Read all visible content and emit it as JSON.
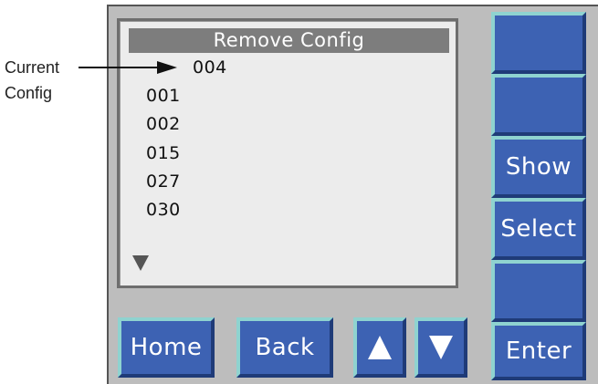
{
  "callout": {
    "line1": "Current",
    "line2": "Config"
  },
  "screen": {
    "title": "Remove Config",
    "current_config": "004",
    "configs": [
      "001",
      "002",
      "015",
      "027",
      "030"
    ],
    "scroll_indicator_icon": "triangle-down-icon"
  },
  "side_buttons": {
    "blank_1": "",
    "blank_2": "",
    "show": "Show",
    "select": "Select",
    "blank_3": "",
    "enter": "Enter"
  },
  "bottom_buttons": {
    "home": "Home",
    "back": "Back",
    "up_icon": "triangle-up-icon",
    "down_icon": "triangle-down-icon"
  },
  "colors": {
    "button_blue": "#3d62b3",
    "button_highlight": "#8fd3d0",
    "panel_gray": "#bdbdbd",
    "screen_bg": "#ececec",
    "title_bar": "#7d7d7d"
  }
}
